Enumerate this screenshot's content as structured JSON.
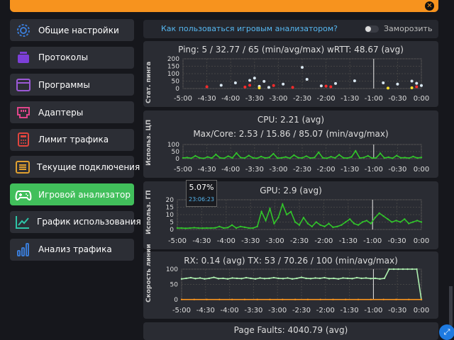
{
  "sidebar": {
    "items": [
      {
        "label": "Общие настройки",
        "icon": "gear-icon",
        "color": "#3a7bd5"
      },
      {
        "label": "Протоколы",
        "icon": "protocols-icon",
        "color": "#7d3fd8"
      },
      {
        "label": "Программы",
        "icon": "window-icon",
        "color": "#9b59d6"
      },
      {
        "label": "Адаптеры",
        "icon": "network-adapter-icon",
        "color": "#e0458a"
      },
      {
        "label": "Лимит трафика",
        "icon": "calculator-icon",
        "color": "#e0453e"
      },
      {
        "label": "Текущие подключения",
        "icon": "list-icon",
        "color": "#e0a030"
      },
      {
        "label": "Игровой анализатор",
        "icon": "gamepad-icon",
        "color": "#ffffff"
      },
      {
        "label": "График использования",
        "icon": "trend-chart-icon",
        "color": "#2ec4a6"
      },
      {
        "label": "Анализ трафика",
        "icon": "bar-chart-icon",
        "color": "#3a7bd5"
      }
    ],
    "active_index": 6
  },
  "header": {
    "help_link": "Как пользоваться игровым анализатором?",
    "freeze_label": "Заморозить"
  },
  "tooltip": {
    "value": "5.07%",
    "time": "23:06:23"
  },
  "chart_data": [
    {
      "type": "scatter",
      "title": "Ping: 5 / 32.77 / 65 (min/avg/max)     wRTT: 48.67 (avg)",
      "ylabel": "Стат. пинга",
      "ylim": [
        0,
        200
      ],
      "yticks": [
        "200",
        "150",
        "100",
        "50",
        "0"
      ],
      "xticks": [
        "-5:00",
        "-4:30",
        "-4:00",
        "-3:30",
        "-3:00",
        "-2:30",
        "-2:00",
        "-1:30",
        "-1:00",
        "-0:30",
        "0:00"
      ],
      "series": [
        {
          "color": "#d8e6f0",
          "points": [
            [
              -4.2,
              22
            ],
            [
              -3.9,
              38
            ],
            [
              -3.6,
              55
            ],
            [
              -3.5,
              70
            ],
            [
              -3.4,
              15
            ],
            [
              -3.3,
              48
            ],
            [
              -3.2,
              8
            ],
            [
              -2.9,
              30
            ],
            [
              -2.5,
              142
            ],
            [
              -2.4,
              62
            ],
            [
              -2.1,
              18
            ],
            [
              -1.8,
              34
            ],
            [
              -1.4,
              52
            ],
            [
              -0.8,
              38
            ],
            [
              -0.5,
              30
            ],
            [
              -0.2,
              50
            ],
            [
              -0.1,
              35
            ],
            [
              0,
              20
            ]
          ]
        },
        {
          "color": "#ff2a2a",
          "points": [
            [
              -4.5,
              12
            ],
            [
              -3.7,
              10
            ],
            [
              -3.6,
              22
            ],
            [
              -3.1,
              20
            ],
            [
              -2.7,
              8
            ],
            [
              -2.0,
              16
            ],
            [
              -1.9,
              12
            ],
            [
              -0.1,
              12
            ]
          ]
        },
        {
          "color": "#ffe02a",
          "points": [
            [
              -3.4,
              4
            ],
            [
              -0.7,
              3
            ],
            [
              -0.2,
              5
            ]
          ]
        }
      ]
    },
    {
      "type": "line",
      "title": "CPU: 2.21 (avg)",
      "subtitle": "Max/Core: 2.53 / 15.86 / 85.07 (min/avg/max)",
      "ylabel": "Использ. ЦП",
      "ylim": [
        0,
        100
      ],
      "yticks": [
        "100",
        "50",
        "0"
      ],
      "xticks": [
        "-5:00",
        "-4:30",
        "-4:00",
        "-3:30",
        "-3:00",
        "-2:30",
        "-2:00",
        "-1:30",
        "-1:00",
        "-0:30",
        "0:00"
      ],
      "series": [
        {
          "color": "#31c52a",
          "values": [
            5,
            8,
            3,
            20,
            6,
            2,
            12,
            4,
            30,
            6,
            3,
            18,
            5,
            40,
            8,
            4,
            22,
            6,
            3,
            15,
            5,
            9,
            35,
            4,
            6,
            12,
            3,
            25,
            7,
            5,
            18,
            4,
            8,
            45,
            6,
            3,
            14,
            5,
            28,
            6,
            4,
            12,
            55,
            5,
            8,
            20,
            4,
            6,
            38,
            5,
            10,
            3,
            22,
            6,
            8,
            4,
            15,
            5,
            9
          ]
        }
      ]
    },
    {
      "type": "line",
      "title": "GPU: 2.9 (avg)",
      "ylabel": "Использ. ГП",
      "ylim": [
        0,
        20
      ],
      "yticks": [
        "20",
        "15",
        "10",
        "5",
        "0"
      ],
      "xticks": [
        "-5:00",
        "-4:30",
        "-4:00",
        "-3:30",
        "-3:00",
        "-2:30",
        "-2:00",
        "-1:30",
        "-1:00",
        "-0:30",
        "0:00"
      ],
      "series": [
        {
          "color": "#31c52a",
          "values": [
            1,
            1,
            0.8,
            1,
            1.2,
            1,
            0.9,
            1,
            1,
            1.1,
            2,
            1,
            1.3,
            3,
            1,
            2,
            1.5,
            1,
            1,
            2,
            12,
            6,
            14,
            4,
            8,
            17,
            10,
            12,
            5,
            3,
            8,
            4,
            2,
            5,
            3,
            2,
            4,
            1.5,
            2,
            3,
            5,
            7,
            4,
            3,
            5,
            6,
            4,
            8,
            11,
            9,
            7,
            5,
            6,
            5,
            7,
            4,
            5,
            6,
            5
          ]
        }
      ]
    },
    {
      "type": "line",
      "title": "RX: 0.14 (avg)     TX: 53 / 70.26 / 100 (min/avg/max)",
      "ylabel": "Скорость линии",
      "ylim": [
        0,
        100
      ],
      "yticks": [
        "100",
        "50",
        "0"
      ],
      "xticks": [
        "-5:00",
        "-4:30",
        "-4:00",
        "-3:30",
        "-3:00",
        "-2:30",
        "-2:00",
        "-1:30",
        "-1:00",
        "-0:30",
        "0:00"
      ],
      "series": [
        {
          "color": "#aef0b0",
          "values": [
            68,
            70,
            72,
            69,
            71,
            68,
            70,
            73,
            69,
            70,
            68,
            71,
            70,
            69,
            72,
            70,
            68,
            71,
            69,
            70,
            72,
            70,
            69,
            71,
            68,
            70,
            73,
            70,
            69,
            71,
            70,
            72,
            69,
            70,
            68,
            71,
            70,
            69,
            72,
            70,
            71,
            69,
            70,
            68,
            70,
            100,
            100,
            100,
            100,
            100,
            100,
            100,
            0
          ]
        },
        {
          "color": "#f7931e",
          "values": [
            0.5,
            0.5,
            0.5,
            0.5,
            0.5,
            0.5,
            0.5,
            0.5,
            0.5,
            0.5,
            0.5,
            0.5,
            0.5,
            0.5,
            0.5,
            0.5,
            0.5,
            0.5,
            0.5,
            0.5
          ]
        }
      ]
    },
    {
      "type": "line",
      "title": "Page Faults: 4040.79 (avg)"
    }
  ]
}
